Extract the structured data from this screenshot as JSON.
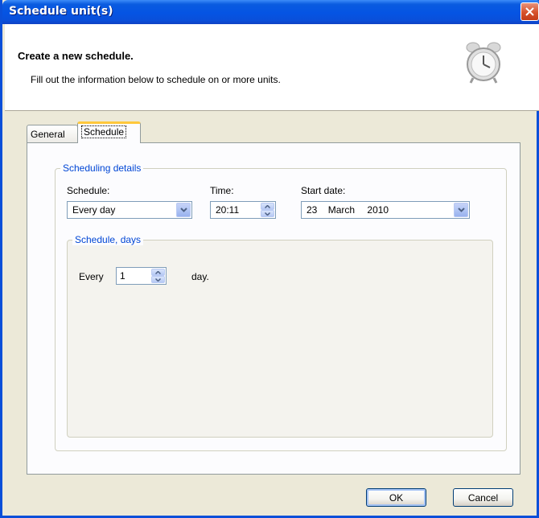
{
  "window": {
    "title": "Schedule unit(s)"
  },
  "header": {
    "title": "Create a new schedule.",
    "description": "Fill out the information below to schedule on or more units."
  },
  "tabs": [
    {
      "label": "General",
      "active": false
    },
    {
      "label": "Schedule",
      "active": true
    }
  ],
  "details": {
    "group_title": "Scheduling details",
    "schedule_label": "Schedule:",
    "schedule_value": "Every day",
    "time_label": "Time:",
    "time_value": "20:11",
    "start_date_label": "Start date:",
    "start_date": {
      "day": "23",
      "month": "March",
      "year": "2010"
    }
  },
  "days": {
    "group_title": "Schedule, days",
    "every_label": "Every",
    "every_value": "1",
    "unit_label": "day."
  },
  "buttons": {
    "ok": "OK",
    "cancel": "Cancel"
  },
  "colors": {
    "titlebar": "#0A4FD9",
    "group_title": "#0046D5",
    "tab_highlight": "#FFC83C"
  }
}
